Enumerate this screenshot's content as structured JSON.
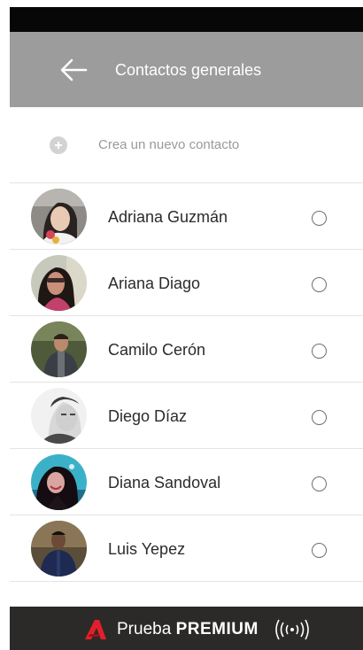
{
  "header": {
    "title": "Contactos generales",
    "back_icon": "arrow-left-icon"
  },
  "new_contact": {
    "label": "Crea un nuevo contacto",
    "icon": "plus-circle-icon"
  },
  "contacts": [
    {
      "name": "Adriana Guzmán",
      "selected": false
    },
    {
      "name": "Ariana Diago",
      "selected": false
    },
    {
      "name": "Camilo Cerón",
      "selected": false
    },
    {
      "name": "Diego Díaz",
      "selected": false
    },
    {
      "name": "Diana Sandoval",
      "selected": false
    },
    {
      "name": "Luis Yepez",
      "selected": false
    }
  ],
  "premium": {
    "prefix": "Prueba",
    "bold": "PREMIUM",
    "icons": [
      "brand-a-logo-icon",
      "nfc-waves-icon"
    ],
    "logo_color": "#e3202a"
  },
  "colors": {
    "app_bar": "#9c9c9c",
    "status_bar": "#070707",
    "banner": "#2b2a28"
  }
}
